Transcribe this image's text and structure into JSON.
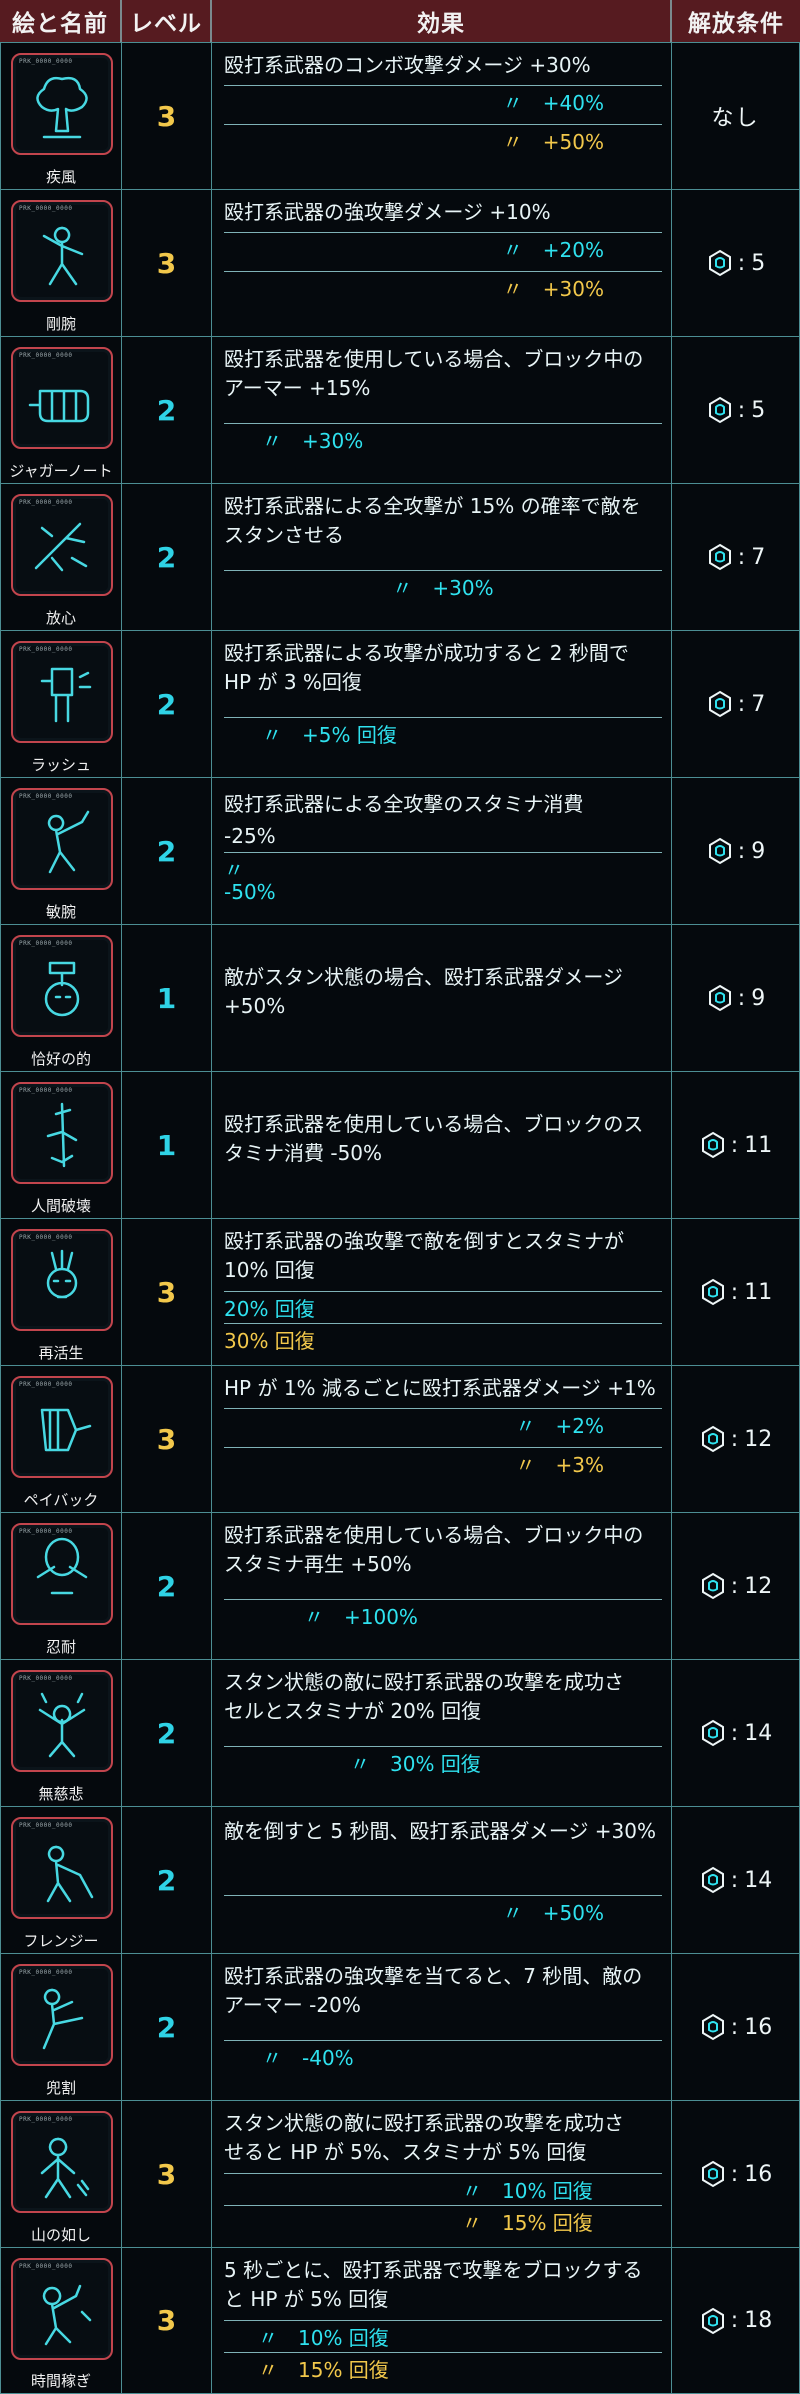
{
  "header": {
    "col_icon": "絵と名前",
    "col_level": "レベル",
    "col_effect": "効果",
    "col_unlock": "解放条件"
  },
  "rows": [
    {
      "name": "疾風",
      "code": "PRK_0000_0000",
      "level": "3",
      "level_color": "#f2c84b",
      "icon": "mushroom-cloud-icon",
      "unlock": "なし",
      "unlock_icon": false,
      "effects": [
        {
          "text": "殴打系武器のコンボ攻撃ダメージ +30%",
          "color": "white",
          "align": "left"
        },
        {
          "text": "〃　+40%",
          "color": "cyan",
          "align": "right"
        },
        {
          "text": "〃　+50%",
          "color": "yellow",
          "align": "right"
        }
      ]
    },
    {
      "name": "剛腕",
      "code": "PRK_0000_0000",
      "level": "3",
      "level_color": "#f2c84b",
      "icon": "fighter-icon",
      "unlock": "5",
      "unlock_icon": true,
      "effects": [
        {
          "text": "殴打系武器の強攻撃ダメージ +10%",
          "color": "white",
          "align": "left"
        },
        {
          "text": "〃　+20%",
          "color": "cyan",
          "align": "right"
        },
        {
          "text": "〃　+30%",
          "color": "yellow",
          "align": "right"
        }
      ]
    },
    {
      "name": "ジャガーノート",
      "code": "PRK_0000_0000",
      "level": "2",
      "level_color": "#2fd3e6",
      "icon": "fist-icon",
      "unlock": "5",
      "unlock_icon": true,
      "effects": [
        {
          "text": "殴打系武器を使用している場合、ブロック中の",
          "color": "white",
          "align": "left"
        },
        {
          "text": "アーマー +15%",
          "color": "white",
          "align": "left"
        },
        {
          "text": "〃　+30%",
          "color": "cyan",
          "align": "indent"
        }
      ]
    },
    {
      "name": "放心",
      "code": "PRK_0000_0000",
      "level": "2",
      "level_color": "#2fd3e6",
      "icon": "shattered-weapon-icon",
      "unlock": "7",
      "unlock_icon": true,
      "effects": [
        {
          "text": "殴打系武器による全攻撃が 15% の確率で敵を",
          "color": "white",
          "align": "left"
        },
        {
          "text": "スタンさせる",
          "color": "white",
          "align": "left"
        },
        {
          "text": "〃　+30%",
          "color": "cyan",
          "align": "center"
        }
      ]
    },
    {
      "name": "ラッシュ",
      "code": "PRK_0000_0000",
      "level": "2",
      "level_color": "#2fd3e6",
      "icon": "rushing-fist-icon",
      "unlock": "7",
      "unlock_icon": true,
      "effects": [
        {
          "text": "殴打系武器による攻撃が成功すると 2 秒間で",
          "color": "white",
          "align": "left"
        },
        {
          "text": "HP が 3 %回復",
          "color": "white",
          "align": "left"
        },
        {
          "text": "〃　+5% 回復",
          "color": "cyan",
          "align": "indent"
        }
      ]
    },
    {
      "name": "敏腕",
      "code": "PRK_0000_0000",
      "level": "2",
      "level_color": "#2fd3e6",
      "icon": "swinging-fighter-icon",
      "unlock": "9",
      "unlock_icon": true,
      "effects": [
        {
          "text": "殴打系武器による全攻撃のスタミナ消費",
          "color": "white",
          "align": "left"
        },
        {
          "text": "-25%",
          "color": "white",
          "align": "left"
        },
        {
          "text": "〃",
          "color": "cyan",
          "align": "left"
        },
        {
          "text": "-50%",
          "color": "cyan",
          "align": "left"
        }
      ]
    },
    {
      "name": "恰好の的",
      "code": "PRK_0000_0000",
      "level": "1",
      "level_color": "#2fd3e6",
      "icon": "target-hand-icon",
      "unlock": "9",
      "unlock_icon": true,
      "effects": [
        {
          "text": "敵がスタン状態の場合、殴打系武器ダメージ",
          "color": "white",
          "align": "left"
        },
        {
          "text": "+50%",
          "color": "white",
          "align": "left"
        }
      ]
    },
    {
      "name": "人間破壊",
      "code": "PRK_0000_0000",
      "level": "1",
      "level_color": "#2fd3e6",
      "icon": "crowbar-icon",
      "unlock": "11",
      "unlock_icon": true,
      "effects": [
        {
          "text": "殴打系武器を使用している場合、ブロックのス",
          "color": "white",
          "align": "left"
        },
        {
          "text": "タミナ消費 -50%",
          "color": "white",
          "align": "left"
        }
      ]
    },
    {
      "name": "再活生",
      "code": "PRK_0000_0000",
      "level": "3",
      "level_color": "#f2c84b",
      "icon": "skull-hand-icon",
      "unlock": "11",
      "unlock_icon": true,
      "effects": [
        {
          "text": "殴打系武器の強攻撃で敵を倒すとスタミナが",
          "color": "white",
          "align": "left"
        },
        {
          "text": "10% 回復",
          "color": "white",
          "align": "left"
        },
        {
          "text": "20% 回復",
          "color": "cyan",
          "align": "left"
        },
        {
          "text": "30% 回復",
          "color": "yellow",
          "align": "left"
        }
      ]
    },
    {
      "name": "ペイバック",
      "code": "PRK_0000_0000",
      "level": "3",
      "level_color": "#f2c84b",
      "icon": "gauntlet-icon",
      "unlock": "12",
      "unlock_icon": true,
      "effects": [
        {
          "text": "HP が 1% 減るごとに殴打系武器ダメージ +1%",
          "color": "white",
          "align": "left"
        },
        {
          "text": "〃　+2%",
          "color": "cyan",
          "align": "right"
        },
        {
          "text": "〃　+3%",
          "color": "yellow",
          "align": "right"
        }
      ]
    },
    {
      "name": "忍耐",
      "code": "PRK_0000_0000",
      "level": "2",
      "level_color": "#2fd3e6",
      "icon": "guarding-face-icon",
      "unlock": "12",
      "unlock_icon": true,
      "effects": [
        {
          "text": "殴打系武器を使用している場合、ブロック中の",
          "color": "white",
          "align": "left"
        },
        {
          "text": "スタミナ再生 +50%",
          "color": "white",
          "align": "left"
        },
        {
          "text": "〃　+100%",
          "color": "cyan",
          "align": "indent2"
        }
      ]
    },
    {
      "name": "無慈悲",
      "code": "PRK_0000_0000",
      "level": "2",
      "level_color": "#2fd3e6",
      "icon": "raging-figure-icon",
      "unlock": "14",
      "unlock_icon": true,
      "effects": [
        {
          "text": "スタン状態の敵に殴打系武器の攻撃を成功さ",
          "color": "white",
          "align": "left"
        },
        {
          "text": "セルとスタミナが 20% 回復",
          "color": "white",
          "align": "left"
        },
        {
          "text": "〃　30% 回復",
          "color": "cyan",
          "align": "indent3"
        }
      ]
    },
    {
      "name": "フレンジー",
      "code": "PRK_0000_0000",
      "level": "2",
      "level_color": "#2fd3e6",
      "icon": "bat-swing-icon",
      "unlock": "14",
      "unlock_icon": true,
      "effects": [
        {
          "text": "敵を倒すと 5 秒間、殴打系武器ダメージ +30%",
          "color": "white",
          "align": "left"
        },
        {
          "text": "〃　+50%",
          "color": "cyan",
          "align": "right"
        }
      ]
    },
    {
      "name": "兜割",
      "code": "PRK_0000_0000",
      "level": "2",
      "level_color": "#2fd3e6",
      "icon": "kick-icon",
      "unlock": "16",
      "unlock_icon": true,
      "effects": [
        {
          "text": "殴打系武器の強攻撃を当てると、7 秒間、敵の",
          "color": "white",
          "align": "left"
        },
        {
          "text": "アーマー -20%",
          "color": "white",
          "align": "left"
        },
        {
          "text": "〃　-40%",
          "color": "cyan",
          "align": "indent"
        }
      ]
    },
    {
      "name": "山の如し",
      "code": "PRK_0000_0000",
      "level": "3",
      "level_color": "#f2c84b",
      "icon": "mountain-figure-icon",
      "unlock": "16",
      "unlock_icon": true,
      "effects": [
        {
          "text": "スタン状態の敵に殴打系武器の攻撃を成功さ",
          "color": "white",
          "align": "left"
        },
        {
          "text": "せると HP が 5%、スタミナが 5% 回復",
          "color": "white",
          "align": "left"
        },
        {
          "text": "〃　10% 回復",
          "color": "cyan",
          "align": "indent4"
        },
        {
          "text": "〃　15% 回復",
          "color": "yellow",
          "align": "indent4"
        }
      ]
    },
    {
      "name": "時間稼ぎ",
      "code": "PRK_0000_0000",
      "level": "3",
      "level_color": "#f2c84b",
      "icon": "blocking-figure-icon",
      "unlock": "18",
      "unlock_icon": true,
      "effects": [
        {
          "text": "5 秒ごとに、殴打系武器で攻撃をブロックする",
          "color": "white",
          "align": "left"
        },
        {
          "text": "と HP が 5% 回復",
          "color": "white",
          "align": "left"
        },
        {
          "text": "〃　10% 回復",
          "color": "cyan",
          "align": "indent5"
        },
        {
          "text": "〃　15% 回復",
          "color": "yellow",
          "align": "indent5"
        }
      ]
    }
  ]
}
